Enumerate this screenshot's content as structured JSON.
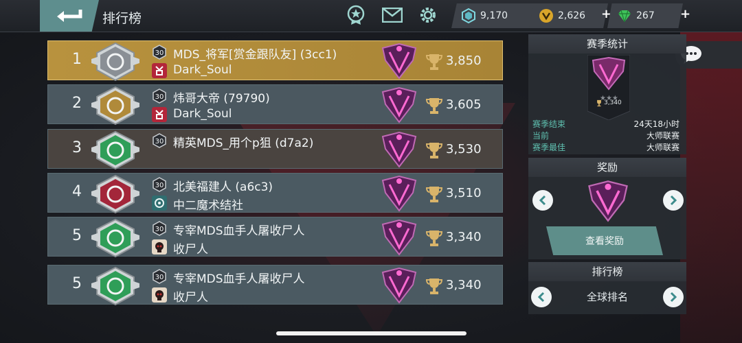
{
  "header": {
    "title": "排行榜",
    "currencies": [
      {
        "name": "crystal",
        "value": "9,170",
        "has_plus": false
      },
      {
        "name": "gold-coin",
        "value": "2,626",
        "has_plus": true
      },
      {
        "name": "gem",
        "value": "267",
        "has_plus": true
      }
    ]
  },
  "leaderboard": [
    {
      "rank": "1",
      "level": "30",
      "name": "MDS_将军[赏金跟队友] (3cc1)",
      "clan": "Dark_Soul",
      "score": "3,850",
      "highlight": true,
      "badge_color": "#8a8f95",
      "clan_icon": "red"
    },
    {
      "rank": "2",
      "level": "30",
      "name": "炜哥大帝 (79790)",
      "clan": "Dark_Soul",
      "score": "3,605",
      "highlight": false,
      "badge_color": "#b08a3a",
      "clan_icon": "red"
    },
    {
      "rank": "3",
      "level": "30",
      "name": "精英MDS_用个p狙 (d7a2)",
      "clan": "",
      "score": "3,530",
      "highlight": false,
      "badge_color": "#2f9e58",
      "clan_icon": "none"
    },
    {
      "rank": "4",
      "level": "30",
      "name": "北美福建人 (a6c3)",
      "clan": "中二魔术结社",
      "score": "3,510",
      "highlight": false,
      "badge_color": "#a3263a",
      "clan_icon": "teal"
    },
    {
      "rank": "5",
      "level": "30",
      "name": "专宰MDS血手人屠收尸人",
      "clan": "收尸人",
      "score": "3,340",
      "highlight": false,
      "badge_color": "#2f9e58",
      "clan_icon": "skull"
    },
    {
      "rank": "5",
      "level": "30",
      "name": "专宰MDS血手人屠收尸人",
      "clan": "收尸人",
      "score": "3,340",
      "highlight": false,
      "badge_color": "#2f9e58",
      "clan_icon": "skull"
    }
  ],
  "season_stats": {
    "title": "赛季统计",
    "trophy_score": "3,340",
    "rows": [
      {
        "key": "赛季结束",
        "value": "24天18小时"
      },
      {
        "key": "当前",
        "value": "大师联赛"
      },
      {
        "key": "赛季最佳",
        "value": "大师联赛"
      }
    ]
  },
  "rewards": {
    "title": "奖励",
    "button": "查看奖励"
  },
  "ranking_panel": {
    "title": "排行榜",
    "selected": "全球排名"
  },
  "colors": {
    "accent": "#5e8e8e",
    "highlight_row": "#b8923e",
    "row": "#4a5a62",
    "stat_key": "#5fc0b0"
  }
}
